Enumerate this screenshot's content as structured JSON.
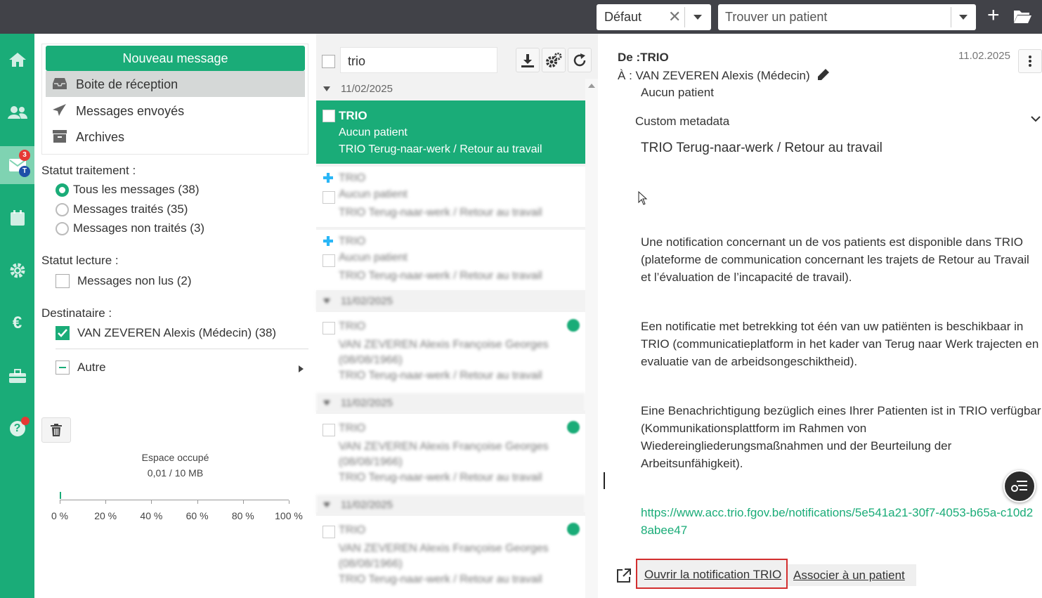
{
  "topbar": {
    "default_select": "Défaut",
    "patient_placeholder": "Trouver un patient"
  },
  "nav": {
    "items": [
      "home",
      "patients",
      "messages",
      "calendar",
      "settings",
      "billing",
      "tools",
      "help"
    ],
    "messages_badge_count": "3",
    "messages_badge_letter": "T"
  },
  "folders": {
    "new_message": "Nouveau message",
    "inbox": "Boite de réception",
    "sent": "Messages envoyés",
    "archives": "Archives"
  },
  "filters": {
    "treatment_title": "Statut traitement :",
    "treatment_options": [
      {
        "label": "Tous les messages (38)",
        "selected": true
      },
      {
        "label": "Messages traités (35)",
        "selected": false
      },
      {
        "label": "Messages non traités (3)",
        "selected": false
      }
    ],
    "read_title": "Statut lecture :",
    "unread_label": "Messages non lus (2)",
    "recipient_title": "Destinataire :",
    "recipient_label": "VAN ZEVEREN Alexis (Médecin) (38)",
    "other_label": "Autre"
  },
  "storage": {
    "label": "Espace occupé",
    "value": "0,01 / 10 MB",
    "fraction": 0.001,
    "ticks": [
      "0 %",
      "20 %",
      "40 %",
      "60 %",
      "80 %",
      "100 %"
    ]
  },
  "list": {
    "search_value": "trio",
    "date_header": "11/02/2025",
    "selected_message": {
      "sender": "TRIO",
      "patient": "Aucun patient",
      "subject": "TRIO Terug-naar-werk / Retour au travail"
    },
    "blurred_lines": {
      "sender": "TRIO",
      "patient": "Aucun patient",
      "subject": "TRIO Terug-naar-werk / Retour au travail",
      "recipient": "VAN ZEVEREN Alexis Françoise Georges (08/08/1966)",
      "date": "11/02/2025"
    }
  },
  "message": {
    "from_label": "De :",
    "from_value": "TRIO",
    "to_label": "À",
    "to_value": ": VAN ZEVEREN Alexis (Médecin)",
    "date": "11.02.2025",
    "patient": "Aucun patient",
    "metadata_label": "Custom metadata",
    "subject": "TRIO Terug-naar-werk / Retour au travail",
    "para_fr": "Une notification concernant un de vos patients est disponible dans TRIO (plateforme de communication concernant les trajets de Retour au Travail et l’évaluation de l’incapacité de travail).",
    "para_nl": "Een notificatie met betrekking tot één van uw patiënten is beschikbaar in TRIO (communicatieplatform in het kader van Terug naar Werk trajecten en evaluatie van de arbeidsongeschiktheid).",
    "para_de": "Eine Benachrichtigung bezüglich eines Ihrer Patienten ist in TRIO verfügbar (Kommunikationsplattform im Rahmen von Wiedereingliederungsmaßnahmen und der Beurteilung der Arbeitsunfähigkeit).",
    "link": "https://www.acc.trio.fgov.be/notifications/5e541a21-30f7-4053-b65a-c10d28abee47",
    "open_button": "Ouvrir la notification TRIO",
    "associate_button": "Associer à un patient"
  },
  "colors": {
    "brand": "#1aac78",
    "topbar": "#414248",
    "highlight_border": "#d32f2f"
  }
}
